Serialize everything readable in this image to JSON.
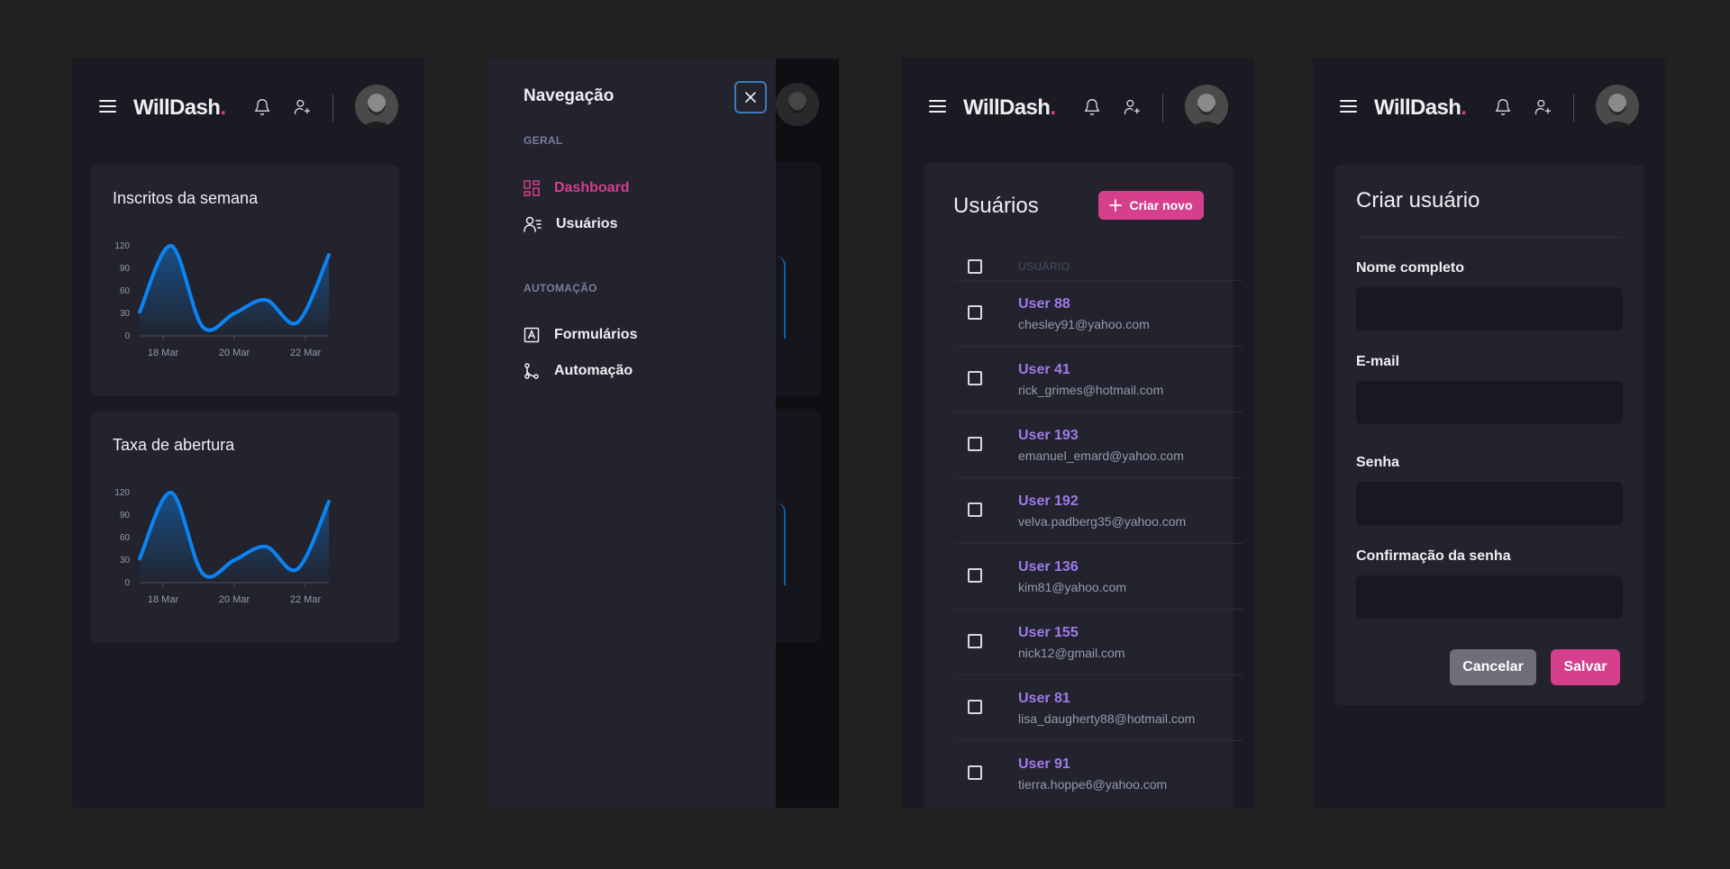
{
  "app": {
    "logo": "WillDash",
    "logo_dot": ".",
    "accent": "#d53f8c",
    "secondary": "#9f7aea"
  },
  "icons": {
    "menu": "menu-icon",
    "notification": "bell-icon",
    "add_user": "user-plus-icon",
    "close": "close-icon",
    "plus": "plus-icon"
  },
  "dashboard": {
    "cards": [
      {
        "title": "Inscritos da semana"
      },
      {
        "title": "Taxa de abertura"
      }
    ]
  },
  "chart_data": [
    {
      "type": "area",
      "title": "Inscritos da semana",
      "y_ticks": [
        "0",
        "30",
        "60",
        "90",
        "120"
      ],
      "x_ticks": [
        "18 Mar",
        "20 Mar",
        "22 Mar"
      ],
      "ylim": [
        0,
        120
      ],
      "xlim": [
        0,
        7
      ],
      "x": [
        0,
        1,
        2,
        3,
        4,
        5,
        6,
        7
      ],
      "values": [
        32,
        120,
        12,
        30,
        48,
        18,
        108
      ],
      "line_color": "#0b84f3"
    },
    {
      "type": "area",
      "title": "Taxa de abertura",
      "y_ticks": [
        "0",
        "30",
        "60",
        "90",
        "120"
      ],
      "x_ticks": [
        "18 Mar",
        "20 Mar",
        "22 Mar"
      ],
      "ylim": [
        0,
        120
      ],
      "xlim": [
        0,
        7
      ],
      "x": [
        0,
        1,
        2,
        3,
        4,
        5,
        6,
        7
      ],
      "values": [
        32,
        120,
        12,
        30,
        48,
        18,
        108
      ],
      "line_color": "#0b84f3"
    }
  ],
  "nav": {
    "title": "Navegação",
    "sections": [
      {
        "label": "GERAL",
        "items": [
          {
            "label": "Dashboard",
            "icon": "dashboard-grid-icon",
            "active": true
          },
          {
            "label": "Usuários",
            "icon": "users-list-icon",
            "active": false
          }
        ]
      },
      {
        "label": "AUTOMAÇÃO",
        "items": [
          {
            "label": "Formulários",
            "icon": "form-icon",
            "active": false
          },
          {
            "label": "Automação",
            "icon": "git-branch-icon",
            "active": false
          }
        ]
      }
    ]
  },
  "users": {
    "title": "Usuários",
    "create_label": "Criar novo",
    "column_header": "USUÁRIO",
    "rows": [
      {
        "name": "User 88",
        "email": "chesley91@yahoo.com"
      },
      {
        "name": "User 41",
        "email": "rick_grimes@hotmail.com"
      },
      {
        "name": "User 193",
        "email": "emanuel_emard@yahoo.com"
      },
      {
        "name": "User 192",
        "email": "velva.padberg35@yahoo.com"
      },
      {
        "name": "User 136",
        "email": "kim81@yahoo.com"
      },
      {
        "name": "User 155",
        "email": "nick12@gmail.com"
      },
      {
        "name": "User 81",
        "email": "lisa_daugherty88@hotmail.com"
      },
      {
        "name": "User 91",
        "email": "tierra.hoppe6@yahoo.com"
      }
    ]
  },
  "create_user": {
    "title": "Criar usuário",
    "fields": [
      {
        "label": "Nome completo",
        "value": ""
      },
      {
        "label": "E-mail",
        "value": ""
      },
      {
        "label": "Senha",
        "value": ""
      },
      {
        "label": "Confirmação da senha",
        "value": ""
      }
    ],
    "cancel_label": "Cancelar",
    "save_label": "Salvar"
  }
}
